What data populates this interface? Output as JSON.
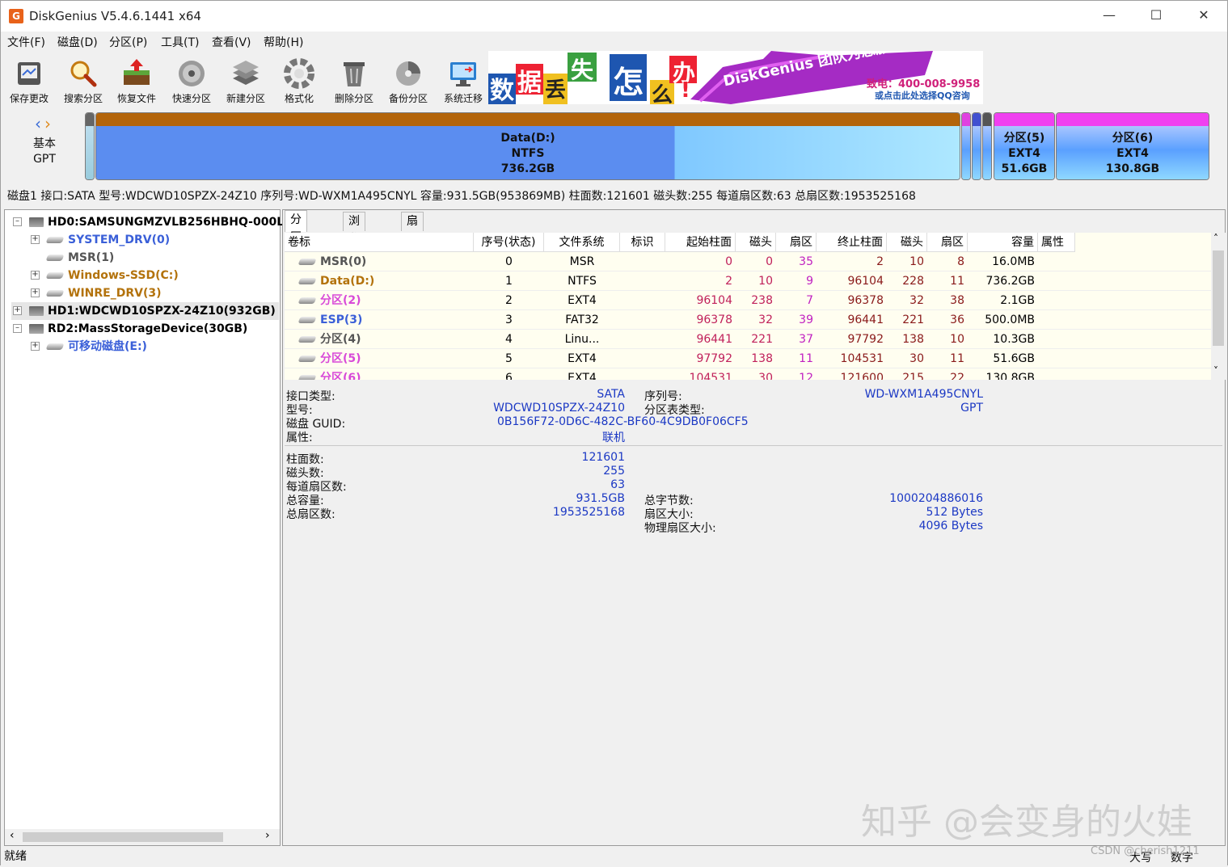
{
  "window": {
    "title": "DiskGenius V5.4.6.1441 x64"
  },
  "menu": [
    "文件(F)",
    "磁盘(D)",
    "分区(P)",
    "工具(T)",
    "查看(V)",
    "帮助(H)"
  ],
  "toolbar": [
    "保存更改",
    "搜索分区",
    "恢复文件",
    "快速分区",
    "新建分区",
    "格式化",
    "删除分区",
    "备份分区",
    "系统迁移"
  ],
  "banner": {
    "chars": [
      "数",
      "据",
      "丢",
      "失",
      "怎",
      "么",
      "办"
    ],
    "bang": "!",
    "slogan": "DiskGenius 团队为您服务",
    "phone": "致电：400-008-9958",
    "qq": "或点击此处选择QQ咨询"
  },
  "diskmap": {
    "type_line1": "基本",
    "type_line2": "GPT",
    "main_part": {
      "name": "Data(D:)",
      "fs": "NTFS",
      "size": "736.2GB"
    },
    "part5": {
      "name": "分区(5)",
      "fs": "EXT4",
      "size": "51.6GB"
    },
    "part6": {
      "name": "分区(6)",
      "fs": "EXT4",
      "size": "130.8GB"
    },
    "used_fraction": 0.67
  },
  "disk_info_line": "磁盘1 接口:SATA  型号:WDCWD10SPZX-24Z10  序列号:WD-WXM1A495CNYL  容量:931.5GB(953869MB)  柱面数:121601  磁头数:255  每道扇区数:63  总扇区数:1953525168",
  "tree": {
    "items": [
      {
        "label": "HD0:SAMSUNGMZVLB256HBHQ-000L",
        "color": "#000000"
      },
      {
        "label": "SYSTEM_DRV(0)",
        "color": "#3a5fd8"
      },
      {
        "label": "MSR(1)",
        "color": "#555555"
      },
      {
        "label": "Windows-SSD(C:)",
        "color": "#b3720b"
      },
      {
        "label": "WINRE_DRV(3)",
        "color": "#b3720b"
      },
      {
        "label": "HD1:WDCWD10SPZX-24Z10(932GB)",
        "color": "#000000"
      },
      {
        "label": "RD2:MassStorageDevice(30GB)",
        "color": "#000000"
      },
      {
        "label": "可移动磁盘(E:)",
        "color": "#3a5fd8"
      }
    ]
  },
  "tabs": [
    "分区参数",
    "浏览文件",
    "扇区编辑"
  ],
  "grid": {
    "headers": [
      "卷标",
      "序号(状态)",
      "文件系统",
      "标识",
      "起始柱面",
      "磁头",
      "扇区",
      "终止柱面",
      "磁头",
      "扇区",
      "容量",
      "属性"
    ],
    "rows": [
      {
        "name": "MSR(0)",
        "color": "#555555",
        "cells": [
          "0",
          "MSR",
          "",
          "0",
          "0",
          "35",
          "2",
          "10",
          "8",
          "16.0MB",
          ""
        ]
      },
      {
        "name": "Data(D:)",
        "color": "#b3720b",
        "cells": [
          "1",
          "NTFS",
          "",
          "2",
          "10",
          "9",
          "96104",
          "228",
          "11",
          "736.2GB",
          ""
        ]
      },
      {
        "name": "分区(2)",
        "color": "#d84ad8",
        "cells": [
          "2",
          "EXT4",
          "",
          "96104",
          "238",
          "7",
          "96378",
          "32",
          "38",
          "2.1GB",
          ""
        ]
      },
      {
        "name": "ESP(3)",
        "color": "#3a5fd8",
        "cells": [
          "3",
          "FAT32",
          "",
          "96378",
          "32",
          "39",
          "96441",
          "221",
          "36",
          "500.0MB",
          ""
        ]
      },
      {
        "name": "分区(4)",
        "color": "#555555",
        "cells": [
          "4",
          "Linu...",
          "",
          "96441",
          "221",
          "37",
          "97792",
          "138",
          "10",
          "10.3GB",
          ""
        ]
      },
      {
        "name": "分区(5)",
        "color": "#d84ad8",
        "cells": [
          "5",
          "EXT4",
          "",
          "97792",
          "138",
          "11",
          "104531",
          "30",
          "11",
          "51.6GB",
          ""
        ]
      },
      {
        "name": "分区(6)",
        "color": "#d84ad8",
        "cells": [
          "6",
          "EXT4",
          "",
          "104531",
          "30",
          "12",
          "121600",
          "215",
          "22",
          "130.8GB",
          ""
        ]
      }
    ]
  },
  "info": {
    "interface_label": "接口类型:",
    "interface": "SATA",
    "serial_label": "序列号:",
    "serial": "WD-WXM1A495CNYL",
    "model_label": "型号:",
    "model": "WDCWD10SPZX-24Z10",
    "ptable_label": "分区表类型:",
    "ptable": "GPT",
    "guid_label": "磁盘 GUID:",
    "guid": "0B156F72-0D6C-482C-BF60-4C9DB0F06CF5",
    "attr_label": "属性:",
    "attr": "联机",
    "cyl_label": "柱面数:",
    "cyl": "121601",
    "heads_label": "磁头数:",
    "heads": "255",
    "spt_label": "每道扇区数:",
    "spt": "63",
    "cap_label": "总容量:",
    "cap": "931.5GB",
    "bytes_label": "总字节数:",
    "bytes": "1000204886016",
    "sectors_label": "总扇区数:",
    "sectors": "1953525168",
    "secsize_label": "扇区大小:",
    "secsize": "512 Bytes",
    "physsec_label": "物理扇区大小:",
    "physsec": "4096 Bytes"
  },
  "status": {
    "left": "就绪",
    "caps": "大写",
    "num": "数字",
    "credit": "CSDN @cherish1211"
  },
  "watermark": "知乎 @会变身的火娃"
}
